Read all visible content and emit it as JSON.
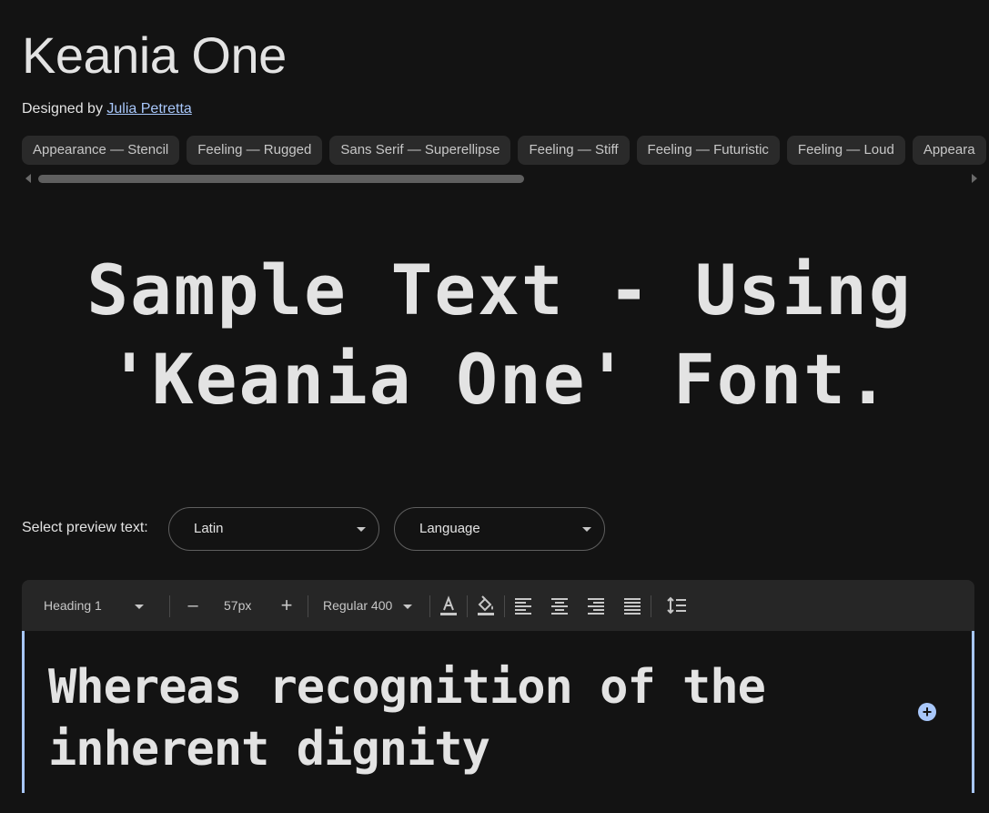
{
  "header": {
    "font_name": "Keania One",
    "designed_by_prefix": "Designed by",
    "designer": "Julia Petretta"
  },
  "tags": [
    "Appearance — Stencil",
    "Feeling — Rugged",
    "Sans Serif — Superellipse",
    "Feeling — Stiff",
    "Feeling — Futuristic",
    "Feeling — Loud",
    "Appearance — Stencil"
  ],
  "tags_visible_last": "Appeara",
  "sample_text": "Sample Text - Using 'Keania One' Font.",
  "preview": {
    "label": "Select preview text:",
    "script_value": "Latin",
    "language_value": "Language"
  },
  "toolbar": {
    "style_value": "Heading 1",
    "decrease_label": "–",
    "size_value": "57px",
    "increase_label": "+",
    "weight_value": "Regular 400"
  },
  "editor": {
    "text": "Whereas recognition of the inherent dignity",
    "add_label": "+"
  },
  "colors": {
    "background": "#131313",
    "accent": "#a8c7fa",
    "chip": "#2a2a2a",
    "toolbar": "#262626"
  }
}
